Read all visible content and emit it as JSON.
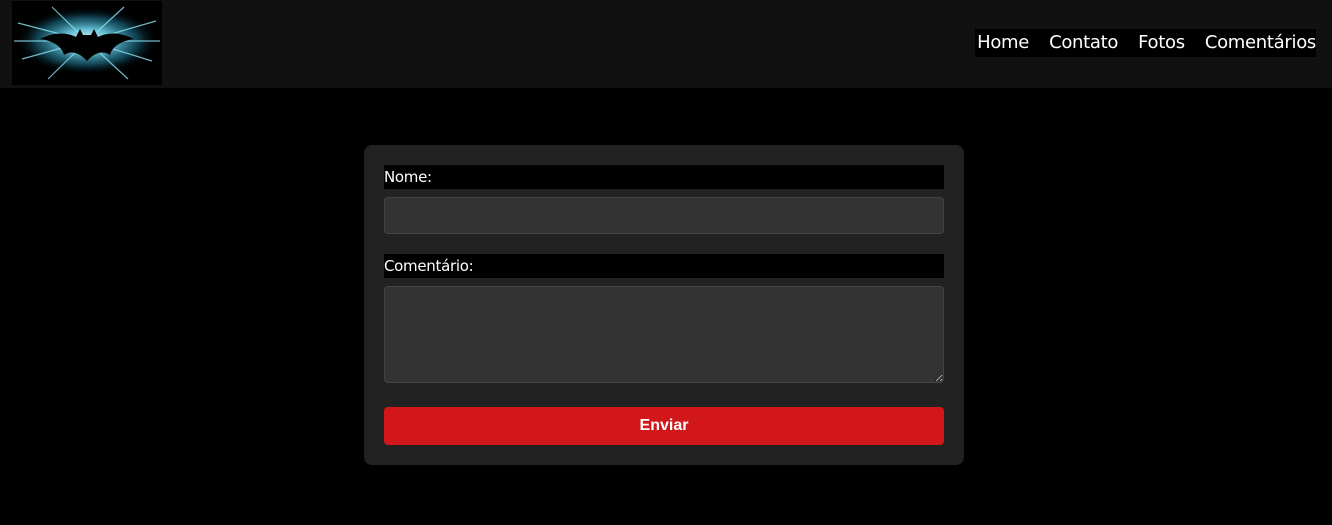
{
  "header": {
    "logo_icon": "bat-signal-logo-icon",
    "nav": [
      {
        "label": "Home"
      },
      {
        "label": "Contato"
      },
      {
        "label": "Fotos"
      },
      {
        "label": "Comentários"
      }
    ]
  },
  "form": {
    "name_label": "Nome:",
    "name_value": "",
    "comment_label": "Comentário:",
    "comment_value": "",
    "submit_label": "Enviar"
  },
  "colors": {
    "background": "#000000",
    "header": "#111111",
    "card": "#222222",
    "input": "#333333",
    "button": "#d1171a",
    "logo_glow": "#6fd3ea"
  }
}
